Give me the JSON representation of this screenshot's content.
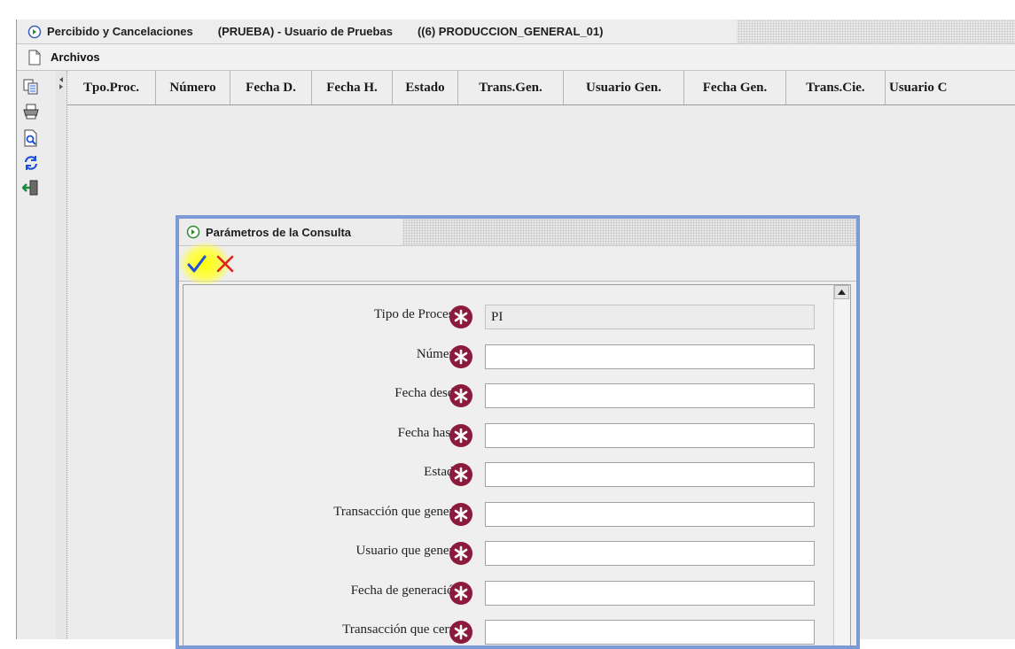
{
  "window": {
    "title_app": "Percibido y Cancelaciones",
    "title_user": "(PRUEBA) - Usuario de Pruebas",
    "title_db": "((6) PRODUCCION_GENERAL_01)"
  },
  "menu": {
    "archivos": "Archivos"
  },
  "toolbar": {
    "icons": [
      "copy-icon",
      "print-icon",
      "preview-icon",
      "refresh-icon",
      "exit-icon"
    ]
  },
  "grid": {
    "columns": [
      "Tpo.Proc.",
      "Número",
      "Fecha D.",
      "Fecha H.",
      "Estado",
      "Trans.Gen.",
      "Usuario Gen.",
      "Fecha Gen.",
      "Trans.Cie.",
      "Usuario C"
    ]
  },
  "dialog": {
    "title": "Parámetros de la Consulta",
    "fields": [
      {
        "label": "Tipo de Proceso",
        "value": "PI"
      },
      {
        "label": "Número",
        "value": ""
      },
      {
        "label": "Fecha desde",
        "value": ""
      },
      {
        "label": "Fecha hasta",
        "value": ""
      },
      {
        "label": "Estado",
        "value": ""
      },
      {
        "label": "Transacción que generó",
        "value": ""
      },
      {
        "label": "Usuario que generó",
        "value": ""
      },
      {
        "label": "Fecha de generación",
        "value": ""
      },
      {
        "label": "Transacción que cerró",
        "value": ""
      }
    ]
  },
  "colors": {
    "dialog_border": "#7b9ad6",
    "required_icon": "#8b1a3d",
    "ok_check": "#1f4fd8",
    "cancel_x": "#e0261b",
    "highlight": "#ffff33"
  }
}
